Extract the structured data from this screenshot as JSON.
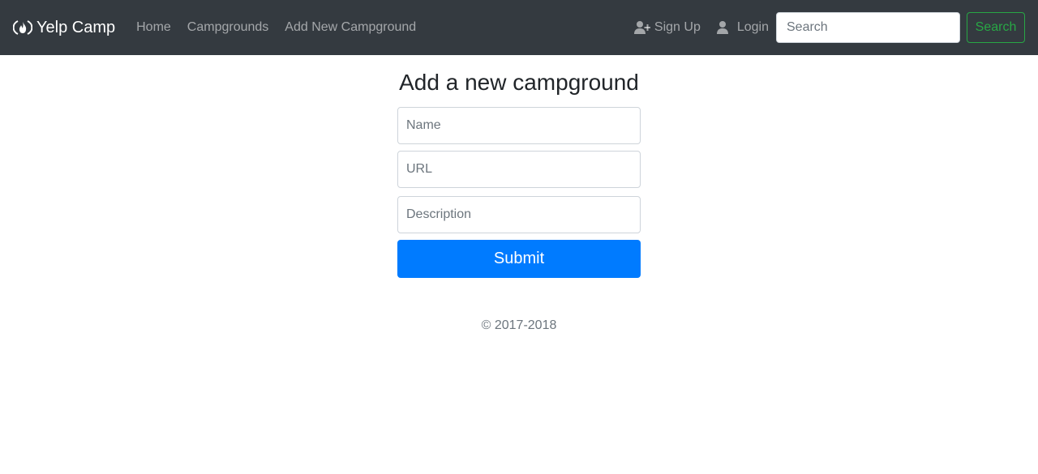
{
  "navbar": {
    "brand": "Yelp Camp",
    "brand_icon": "fire-icon",
    "links": [
      "Home",
      "Campgrounds",
      "Add New Campground"
    ],
    "signup_label": "Sign Up",
    "signup_icon": "user-plus-icon",
    "login_label": "Login",
    "login_icon": "user-icon",
    "search_placeholder": "Search",
    "search_button": "Search"
  },
  "form": {
    "title": "Add a new campground",
    "name_placeholder": "Name",
    "url_placeholder": "URL",
    "description_placeholder": "Description",
    "submit_label": "Submit"
  },
  "footer": {
    "text": "© 2017-2018"
  },
  "colors": {
    "navbar_bg": "#343a40",
    "primary": "#007bff",
    "success": "#28a745"
  }
}
